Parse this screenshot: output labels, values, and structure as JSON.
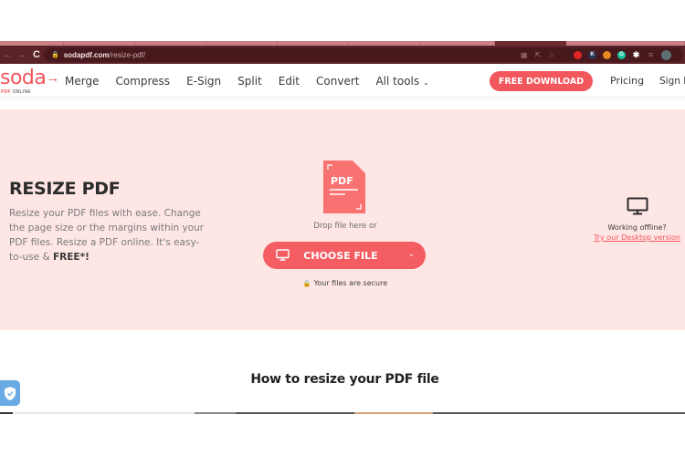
{
  "browser": {
    "url_host": "sodapdf.com",
    "url_path": "/resize-pdf/",
    "nav_back": "←",
    "nav_forward": "→",
    "nav_reload": "C",
    "omnibox_icons": [
      "translate-icon",
      "share-icon",
      "bookmark-star-icon"
    ],
    "extensions": [
      {
        "name": "extension-red",
        "label": "",
        "color": "#e02424"
      },
      {
        "name": "extension-k",
        "label": "K",
        "color": "#2c3553"
      },
      {
        "name": "extension-orange",
        "label": "",
        "color": "#e58a1f"
      },
      {
        "name": "extension-grammarly",
        "label": "G",
        "color": "#15c39a"
      },
      {
        "name": "extensions-puzzle",
        "label": "",
        "color": "#ffffff"
      }
    ]
  },
  "header": {
    "logo_word": "soda",
    "logo_sub_brand": "PDF",
    "logo_sub_text": "ONLINE",
    "nav": [
      {
        "label": "Merge"
      },
      {
        "label": "Compress"
      },
      {
        "label": "E-Sign"
      },
      {
        "label": "Split"
      },
      {
        "label": "Edit"
      },
      {
        "label": "Convert"
      },
      {
        "label": "All tools"
      }
    ],
    "free_download": "FREE DOWNLOAD",
    "pricing": "Pricing",
    "sign_in": "Sign In"
  },
  "hero": {
    "title": "RESIZE PDF",
    "description": "Resize your PDF files with ease. Change the page size or the margins within your PDF files. Resize a PDF online. It's easy-to-use & ",
    "description_bold": "FREE*!",
    "pdf_icon_label": "PDF",
    "drop_text": "Drop file here or",
    "choose_file": "CHOOSE FILE",
    "secure_text": "Your files are secure",
    "offline_text": "Working offline?",
    "desktop_link": "Try our Desktop version"
  },
  "how_to": {
    "title": "How to resize your PDF file"
  },
  "colors": {
    "brand": "#f2545b",
    "hero_bg": "#fee6e5",
    "browser_frame": "#5b2328"
  }
}
